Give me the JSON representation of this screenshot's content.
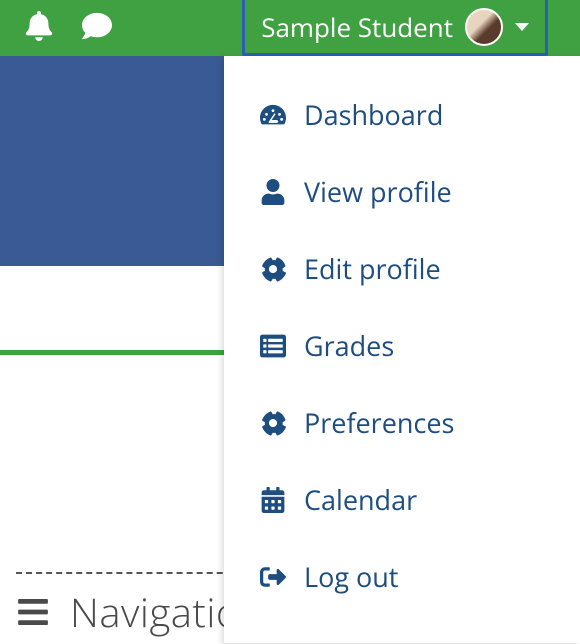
{
  "topbar": {
    "notifications_icon": "bell",
    "messages_icon": "chat-bubble"
  },
  "user": {
    "display_name": "Sample Student"
  },
  "dropdown": {
    "items": [
      {
        "icon": "dashboard",
        "label": "Dashboard"
      },
      {
        "icon": "user",
        "label": "View profile"
      },
      {
        "icon": "cog",
        "label": "Edit profile"
      },
      {
        "icon": "grades",
        "label": "Grades"
      },
      {
        "icon": "cog",
        "label": "Preferences"
      },
      {
        "icon": "calendar",
        "label": "Calendar"
      },
      {
        "icon": "logout",
        "label": "Log out"
      }
    ]
  },
  "navigation": {
    "label": "Navigation"
  },
  "colors": {
    "brand_green": "#3fa142",
    "hero_blue": "#3a5a95",
    "link_blue": "#1e4d80",
    "focus_blue": "#2b5fb3"
  }
}
